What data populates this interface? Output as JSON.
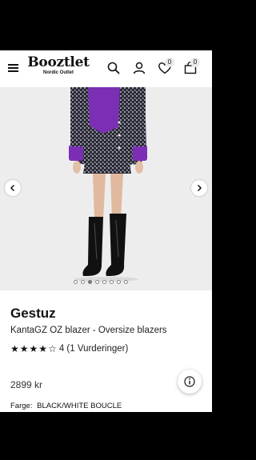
{
  "header": {
    "logo_main": "Booztlet",
    "logo_sub": "Nordic Outlet",
    "favorites_count": "0",
    "cart_count": "0"
  },
  "carousel": {
    "image_count": 8,
    "active_index": 2
  },
  "product": {
    "brand": "Gestuz",
    "name": "KantaGZ OZ blazer - Oversize blazers",
    "rating_value": 4,
    "rating_max": 5,
    "rating_text": "4 (1 Vurderinger)",
    "price": "2899 kr",
    "color_label": "Farge:",
    "color_value": "BLACK/WHITE BOUCLE"
  },
  "colors": {
    "accent_purple": "#7b2fb5",
    "tweed_dark": "#2a2a36",
    "background": "#ededee"
  },
  "icons": [
    "menu-icon",
    "search-icon",
    "user-icon",
    "heart-icon",
    "cart-icon",
    "chevron-left-icon",
    "chevron-right-icon",
    "info-icon",
    "star-icon"
  ]
}
